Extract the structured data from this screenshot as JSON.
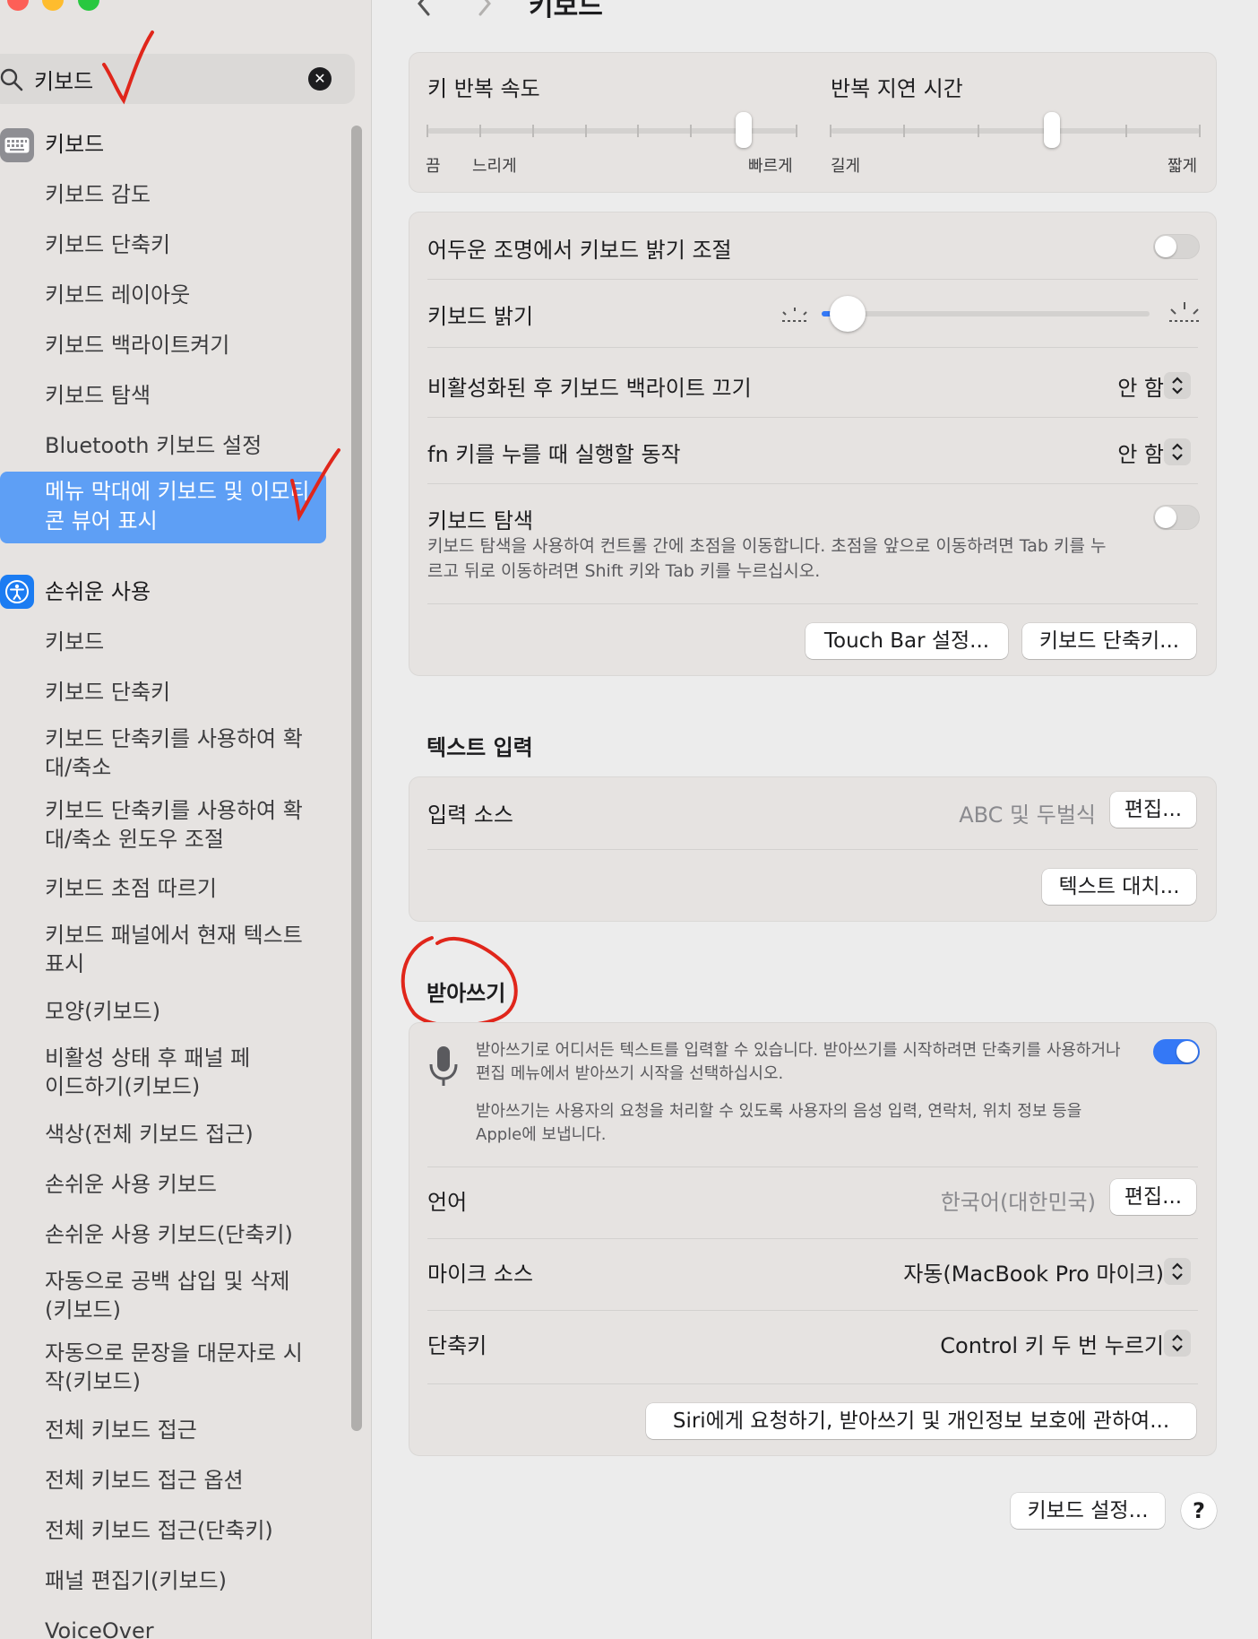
{
  "window": {
    "title": "키보드"
  },
  "search": {
    "value": "키보드",
    "clear_icon": "clear-circle-icon"
  },
  "sidebar": {
    "groups": [
      {
        "header": "키보드",
        "icon": "keyboard-icon",
        "items": [
          "키보드 감도",
          "키보드 단축키",
          "키보드 레이아웃",
          "키보드 백라이트켜기",
          "키보드 탐색",
          "Bluetooth 키보드 설정"
        ],
        "selected_item": "메뉴 막대에 키보드 및 이모티콘 뷰어 표시"
      },
      {
        "header": "손쉬운 사용",
        "icon": "accessibility-icon",
        "items": [
          "키보드",
          "키보드 단축키",
          "키보드 단축키를 사용하여 확대/축소",
          "키보드 단축키를 사용하여 확대/축소 윈도우 조절",
          "키보드 초점 따르기",
          "키보드 패널에서 현재 텍스트 표시",
          "모양(키보드)",
          "비활성 상태 후 패널 페이드하기(키보드)",
          "색상(전체 키보드 접근)",
          "손쉬운 사용 키보드",
          "손쉬운 사용 키보드(단축키)",
          "자동으로 공백 삽입 및 삭제 (키보드)",
          "자동으로 문장을 대문자로 시작(키보드)",
          "전체 키보드 접근",
          "전체 키보드 접근 옵션",
          "전체 키보드 접근(단축키)",
          "패널 편집기(키보드)",
          "VoiceOver"
        ]
      }
    ]
  },
  "key_repeat": {
    "rate_label": "키 반복 속도",
    "rate_min_off": "끔",
    "rate_min": "느리게",
    "rate_max": "빠르게",
    "rate_level": 0.857,
    "delay_label": "반복 지연 시간",
    "delay_min": "길게",
    "delay_max": "짧게",
    "delay_level": 0.6
  },
  "backlight": {
    "auto_adjust_label": "어두운 조명에서 키보드 밝기 조절",
    "auto_adjust_on": false,
    "brightness_label": "키보드 밝기",
    "brightness_level": 0.08,
    "idle_off_label": "비활성화된 후 키보드 백라이트 끄기",
    "idle_off_value": "안 함",
    "fn_label": "fn 키를 누를 때 실행할 동작",
    "fn_value": "안 함",
    "nav_label": "키보드 탐색",
    "nav_desc": "키보드 탐색을 사용하여 컨트롤 간에 초점을 이동합니다. 초점을 앞으로 이동하려면 Tab 키를 누르고 뒤로 이동하려면 Shift 키와 Tab 키를 누르십시오.",
    "nav_on": false,
    "touchbar_button": "Touch Bar 설정...",
    "shortcuts_button": "키보드 단축키..."
  },
  "text_input": {
    "section_title": "텍스트 입력",
    "source_label": "입력 소스",
    "source_value": "ABC 및 두벌식",
    "edit_button": "편집...",
    "replace_button": "텍스트 대치..."
  },
  "dictation": {
    "section_title": "받아쓰기",
    "enabled": true,
    "desc1": "받아쓰기로 어디서든 텍스트를 입력할 수 있습니다. 받아쓰기를 시작하려면 단축키를 사용하거나 편집 메뉴에서 받아쓰기 시작을 선택하십시오.",
    "desc2": "받아쓰기는 사용자의 요청을 처리할 수 있도록 사용자의 음성 입력, 연락처, 위치 정보 등을 Apple에 보냅니다.",
    "language_label": "언어",
    "language_value": "한국어(대한민국)",
    "language_edit_button": "편집...",
    "mic_label": "마이크 소스",
    "mic_value": "자동(MacBook Pro 마이크)",
    "shortcut_label": "단축키",
    "shortcut_value": "Control 키 두 번 누르기",
    "about_button": "Siri에게 요청하기, 받아쓰기 및 개인정보 보호에 관하여..."
  },
  "footer": {
    "keyboard_setup_button": "키보드 설정...",
    "help_button": "?"
  },
  "colors": {
    "accent": "#3478f6",
    "selection": "#5e9ff5",
    "annotation": "#e0261b"
  }
}
